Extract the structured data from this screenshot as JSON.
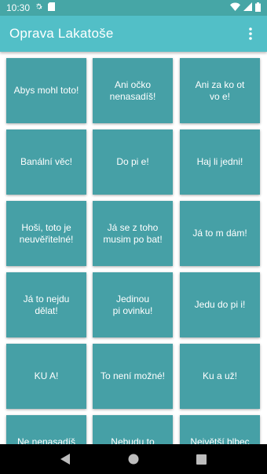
{
  "status": {
    "time": "10:30"
  },
  "app": {
    "title": "Oprava Lakatoše"
  },
  "tiles": [
    "Abys mohl toto!",
    "Ani očko\nnenasadíš!",
    "Ani za ko  ot\nvo e!",
    "Banální věc!",
    "Do pi  e!",
    "Haj  li jedni!",
    "Hoši, toto je\nneuvěřitelné!",
    "Já se z toho\nmusim po  bat!",
    "Já to m  dám!",
    "Já to nejdu\ndělat!",
    "Jedinou\npi  ovinku!",
    "Jedu do pi  i!",
    "KU     A!",
    "To není možné!",
    "Ku    a už!",
    "Ne  nenasadíš",
    "Nebudu to",
    "Největší blbec"
  ],
  "colors": {
    "status_bar": "#46a6a6",
    "app_bar": "#52bfc7",
    "tile": "#46a0a6",
    "nav_bar": "#000000"
  }
}
